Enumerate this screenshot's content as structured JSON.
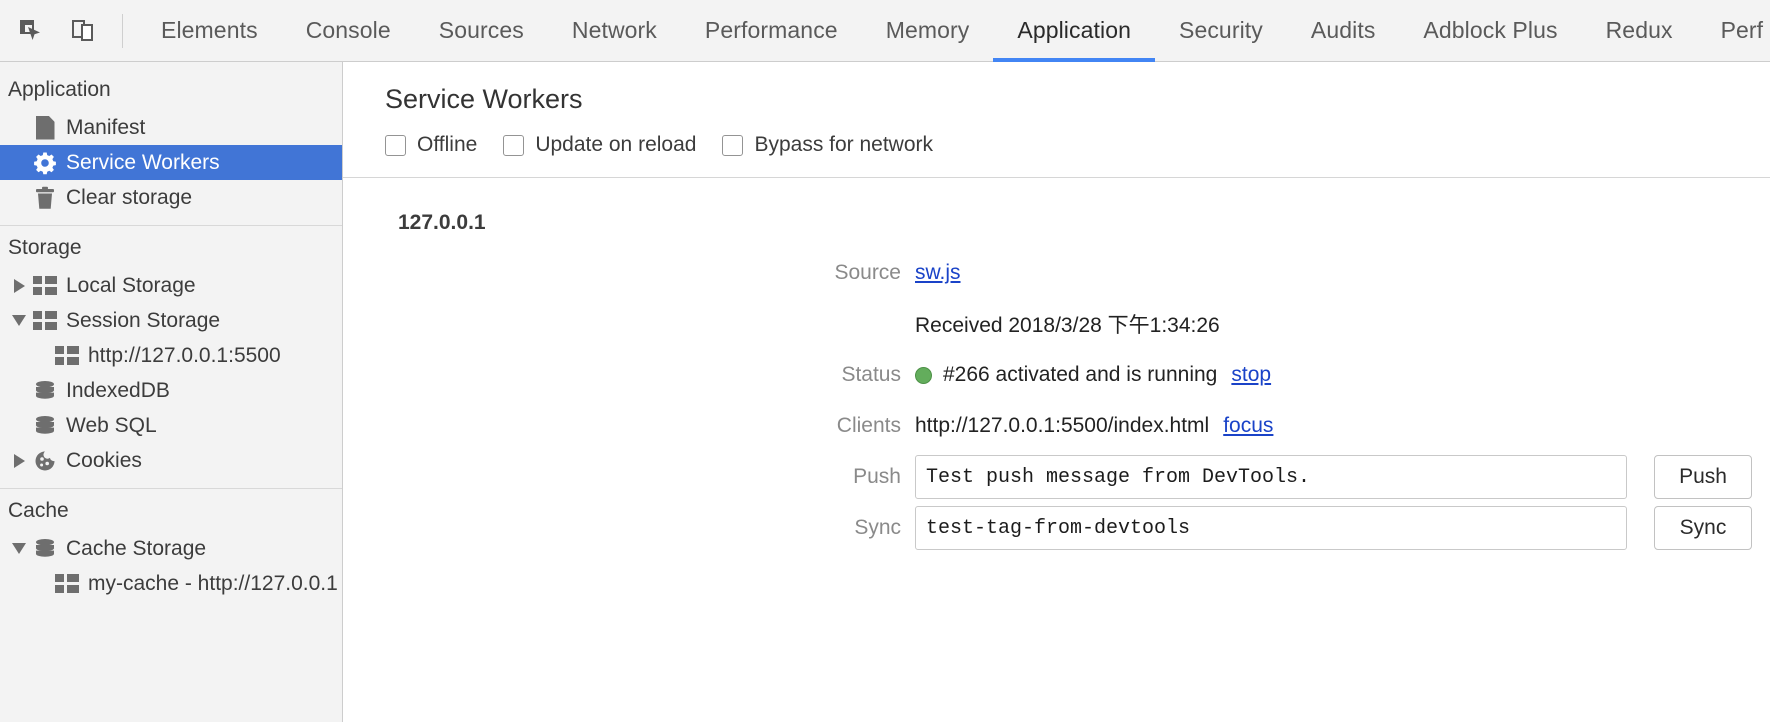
{
  "toolbar": {
    "inspect_icon": "inspect-element-icon",
    "device_icon": "device-toolbar-icon",
    "tabs": [
      {
        "label": "Elements",
        "active": false
      },
      {
        "label": "Console",
        "active": false
      },
      {
        "label": "Sources",
        "active": false
      },
      {
        "label": "Network",
        "active": false
      },
      {
        "label": "Performance",
        "active": false
      },
      {
        "label": "Memory",
        "active": false
      },
      {
        "label": "Application",
        "active": true
      },
      {
        "label": "Security",
        "active": false
      },
      {
        "label": "Audits",
        "active": false
      },
      {
        "label": "Adblock Plus",
        "active": false
      },
      {
        "label": "Redux",
        "active": false
      },
      {
        "label": "Perf",
        "active": false
      }
    ],
    "accent_color": "#4285f4"
  },
  "sidebar": {
    "application_section": {
      "title": "Application",
      "items": [
        {
          "label": "Manifest",
          "icon": "document-icon",
          "selected": false
        },
        {
          "label": "Service Workers",
          "icon": "gear-icon",
          "selected": true
        },
        {
          "label": "Clear storage",
          "icon": "trash-icon",
          "selected": false
        }
      ]
    },
    "storage_section": {
      "title": "Storage",
      "items": [
        {
          "label": "Local Storage",
          "icon": "table-icon",
          "twisty": "collapsed",
          "indent": 0
        },
        {
          "label": "Session Storage",
          "icon": "table-icon",
          "twisty": "expanded",
          "indent": 0
        },
        {
          "label": "http://127.0.0.1:5500",
          "icon": "table-icon",
          "twisty": "none",
          "indent": 1
        },
        {
          "label": "IndexedDB",
          "icon": "database-icon",
          "twisty": "none",
          "indent": 0
        },
        {
          "label": "Web SQL",
          "icon": "database-icon",
          "twisty": "none",
          "indent": 0
        },
        {
          "label": "Cookies",
          "icon": "cookie-icon",
          "twisty": "collapsed",
          "indent": 0
        }
      ]
    },
    "cache_section": {
      "title": "Cache",
      "items": [
        {
          "label": "Cache Storage",
          "icon": "database-icon",
          "twisty": "expanded",
          "indent": 0
        },
        {
          "label": "my-cache - http://127.0.0.1",
          "icon": "table-icon",
          "twisty": "none",
          "indent": 1
        }
      ]
    },
    "selected_color": "#4175d6"
  },
  "main": {
    "title": "Service Workers",
    "options": [
      {
        "label": "Offline",
        "checked": false
      },
      {
        "label": "Update on reload",
        "checked": false
      },
      {
        "label": "Bypass for network",
        "checked": false
      }
    ],
    "origin": "127.0.0.1",
    "rows": {
      "source_label": "Source",
      "source_link": "sw.js",
      "received_text": "Received 2018/3/28 下午1:34:26",
      "status_label": "Status",
      "status_text": "#266 activated and is running",
      "status_action": "stop",
      "status_color": "#63ad5c",
      "clients_label": "Clients",
      "clients_value": "http://127.0.0.1:5500/index.html",
      "clients_action": "focus",
      "push_label": "Push",
      "push_value": "Test push message from DevTools.",
      "push_button": "Push",
      "sync_label": "Sync",
      "sync_value": "test-tag-from-devtools",
      "sync_button": "Sync"
    }
  }
}
